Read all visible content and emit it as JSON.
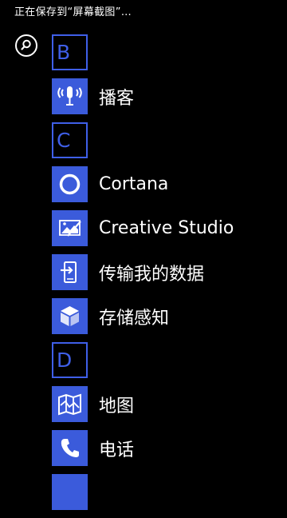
{
  "status_text": "正在保存到“屏幕截图”…",
  "search": {
    "icon": "search-icon"
  },
  "accent_color": "#3b5bdb",
  "sections": {
    "b": {
      "letter": "B"
    },
    "c": {
      "letter": "C"
    },
    "d": {
      "letter": "D"
    }
  },
  "apps": {
    "podcast": {
      "label": "播客",
      "icon": "podcast-microphone-icon"
    },
    "cortana": {
      "label": "Cortana",
      "icon": "cortana-circle-icon"
    },
    "creative_studio": {
      "label": "Creative Studio",
      "icon": "creative-studio-icon"
    },
    "transfer_data": {
      "label": "传输我的数据",
      "icon": "transfer-data-icon"
    },
    "storage_sense": {
      "label": "存储感知",
      "icon": "storage-sense-icon"
    },
    "maps": {
      "label": "地图",
      "icon": "map-icon"
    },
    "phone": {
      "label": "电话",
      "icon": "phone-icon"
    }
  }
}
